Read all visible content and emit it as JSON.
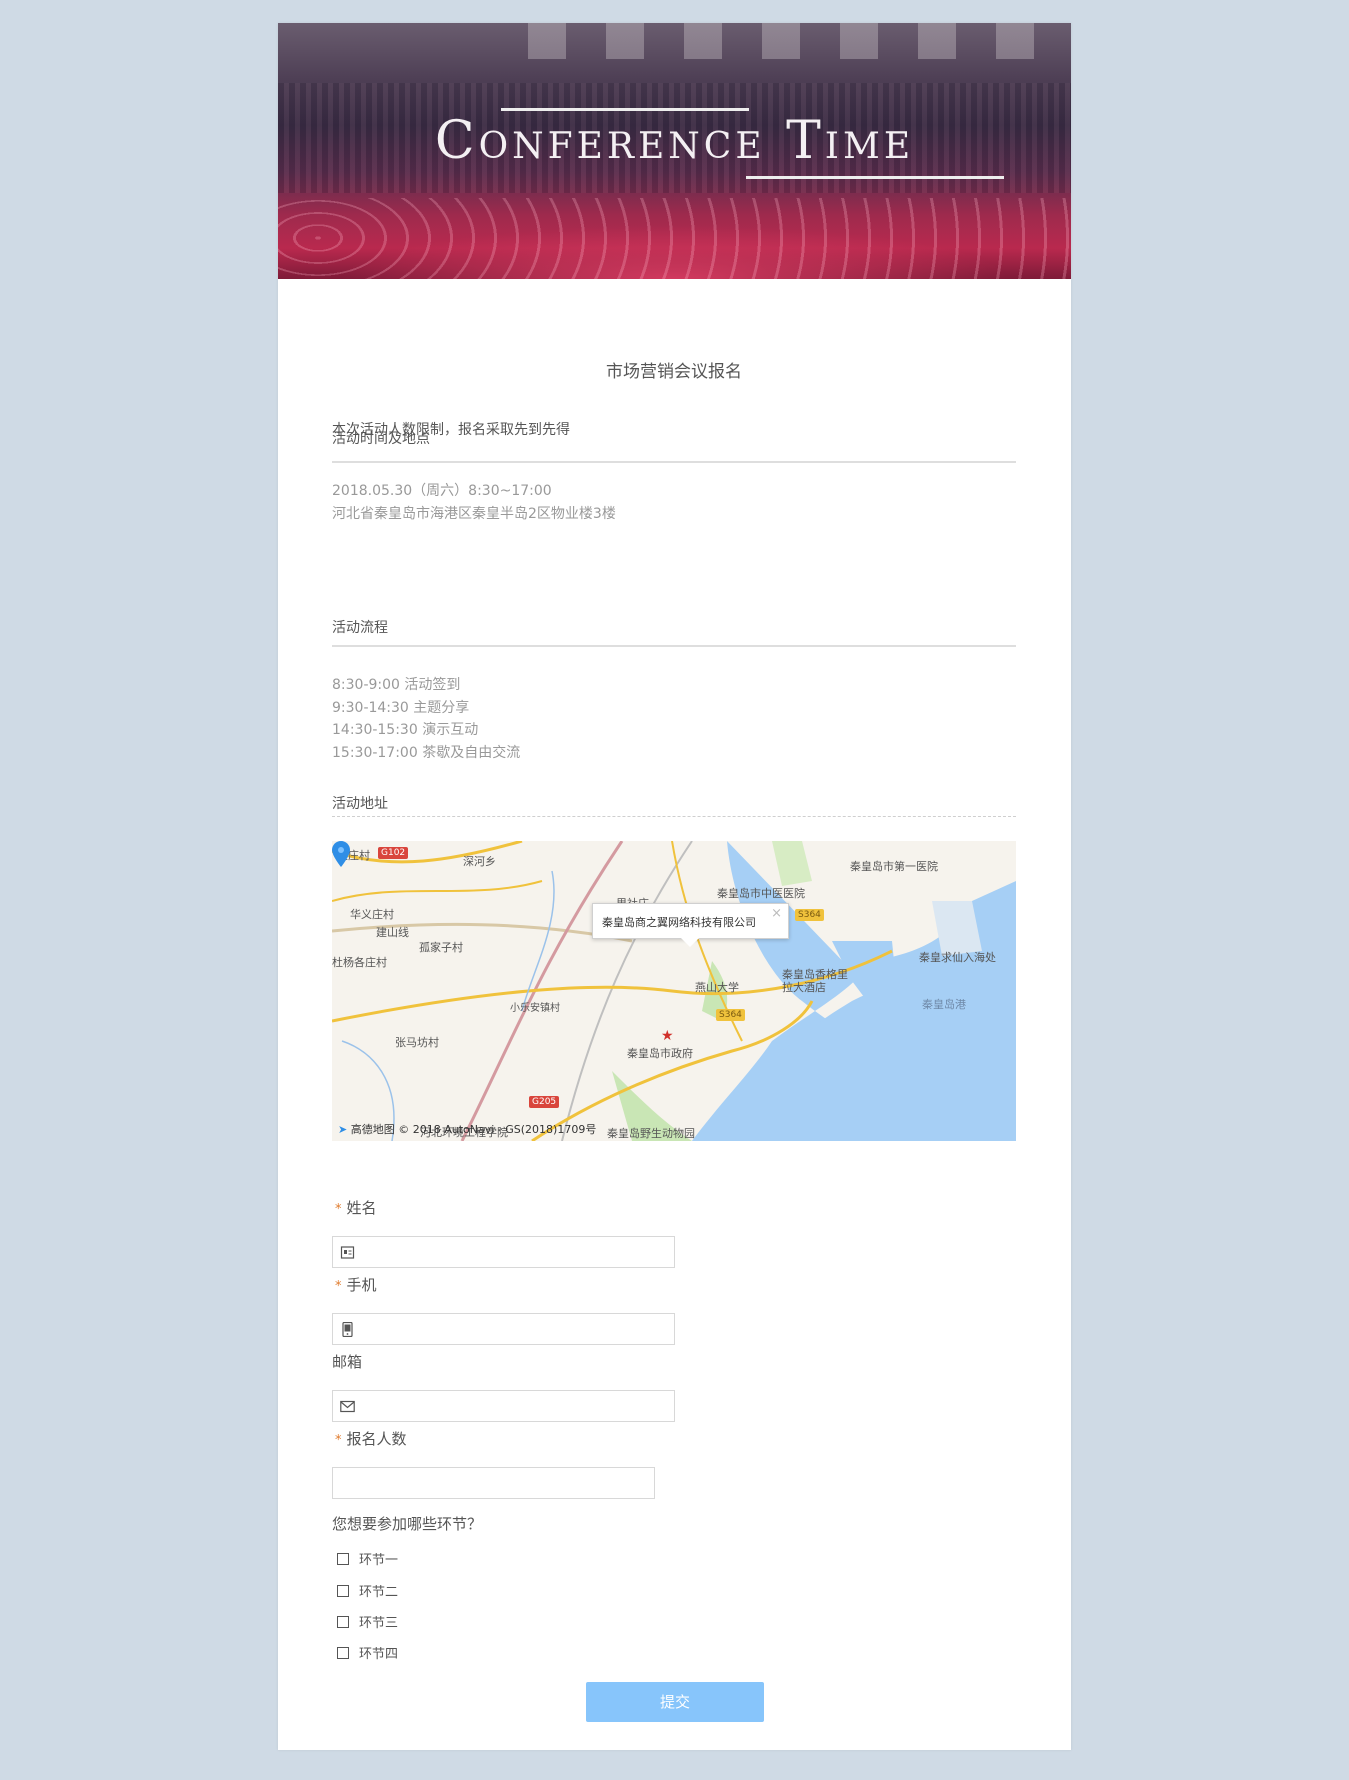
{
  "banner": {
    "title": "Conference Time"
  },
  "form": {
    "title": "市场营销会议报名",
    "notice": "本次活动人数限制，报名采取先到先得",
    "sections": [
      {
        "heading": "活动时间及地点",
        "lines": [
          "2018.05.30（周六）8:30~17:00",
          "河北省秦皇岛市海港区秦皇半岛2区物业楼3楼"
        ]
      },
      {
        "heading": "活动流程",
        "lines": [
          "8:30-9:00 活动签到",
          "9:30-14:30 主题分享",
          "14:30-15:30 演示互动",
          "15:30-17:00 茶歇及自由交流"
        ]
      },
      {
        "heading": "活动地址",
        "lines": []
      }
    ],
    "map": {
      "popup": "秦皇岛商之翼网络科技有限公司",
      "popup_close": "×",
      "attribution": "高德地图 © 2018 AutoNavi - GS(2018)1709号",
      "labels": {
        "l1": "里庄村",
        "l2": "深河乡",
        "l3": "秦皇岛市中医医院",
        "l4": "秦皇岛市第一医院",
        "l5": "华义庄村",
        "l6": "建山线",
        "l7": "孤家子村",
        "l8": "杜杨各庄村",
        "l9": "燕山大学",
        "l10": "秦皇岛香格里拉大酒店",
        "l11": "秦皇求仙入海处",
        "l12": "秦皇岛港",
        "l13": "小乐安镇村",
        "l14": "张马坊村",
        "l15": "秦皇岛市政府",
        "l16": "河北环境工程学院",
        "l17": "秦皇岛野生动物园",
        "l18": "里社庄"
      },
      "shields": {
        "g102": "G102",
        "s364a": "S364",
        "s364b": "S364",
        "g205": "G205"
      }
    },
    "fields": {
      "name": {
        "label": "姓名",
        "required_mark": "*",
        "value": ""
      },
      "phone": {
        "label": "手机",
        "required_mark": "*",
        "value": ""
      },
      "email": {
        "label": "邮箱",
        "value": ""
      },
      "count": {
        "label": "报名人数",
        "required_mark": "*",
        "value": ""
      }
    },
    "question": "您想要参加哪些环节？",
    "options": [
      "环节一",
      "环节二",
      "环节三",
      "环节四"
    ],
    "submit": "提交"
  },
  "colors": {
    "background": "#cfdae5",
    "submit": "#87c5fb",
    "required": "#e07b2e"
  }
}
